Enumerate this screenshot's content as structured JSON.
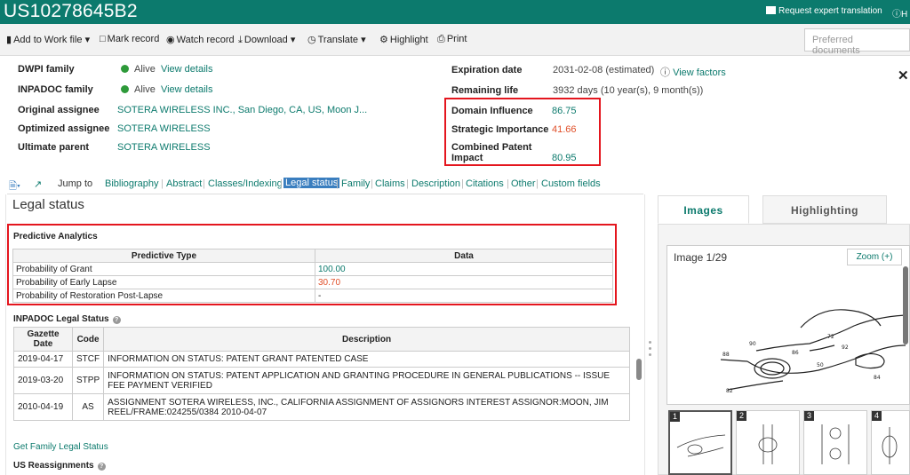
{
  "header": {
    "patent_number": "US10278645B2",
    "request_translation": "Request expert translation",
    "help": "H"
  },
  "toolbar": {
    "add_to_work_file": "Add to Work file",
    "mark_record": "Mark record",
    "watch_record": "Watch record",
    "download": "Download",
    "translate": "Translate",
    "highlight": "Highlight",
    "print": "Print",
    "preferred_placeholder": "Preferred documents"
  },
  "summary": {
    "dwpi_family_label": "DWPI family",
    "dwpi_family_status": "Alive",
    "dwpi_family_link": "View details",
    "inpadoc_family_label": "INPADOC family",
    "inpadoc_family_status": "Alive",
    "inpadoc_family_link": "View details",
    "original_assignee_label": "Original assignee",
    "original_assignee_value": "SOTERA WIRELESS INC., San Diego, CA, US, Moon J...",
    "optimized_assignee_label": "Optimized assignee",
    "optimized_assignee_value": "SOTERA WIRELESS",
    "ultimate_parent_label": "Ultimate parent",
    "ultimate_parent_value": "SOTERA WIRELESS",
    "expiration_label": "Expiration date",
    "expiration_value": "2031-02-08 (estimated)",
    "view_factors": "View factors",
    "remaining_label": "Remaining life",
    "remaining_value": "3932 days (10 year(s), 9 month(s))",
    "domain_influence_label": "Domain Influence",
    "domain_influence_value": "86.75",
    "strategic_importance_label": "Strategic Importance",
    "strategic_importance_value": "41.66",
    "combined_impact_label_1": "Combined Patent",
    "combined_impact_label_2": "Impact",
    "combined_impact_value": "80.95"
  },
  "jumpbar": {
    "jump_to": "Jump to",
    "items": [
      "Bibliography",
      "Abstract",
      "Classes/Indexing",
      "Legal status",
      "Family",
      "Claims",
      "Description",
      "Citations",
      "Other",
      "Custom fields"
    ]
  },
  "legal": {
    "title": "Legal status",
    "predictive_title": "Predictive Analytics",
    "pa_headers": [
      "Predictive Type",
      "Data"
    ],
    "pa_rows": [
      {
        "type": "Probability of Grant",
        "data": "100.00",
        "color": "#0c7a6d"
      },
      {
        "type": "Probability of Early Lapse",
        "data": "30.70",
        "color": "#e0502a"
      },
      {
        "type": "Probability of Restoration Post-Lapse",
        "data": "-",
        "color": "#444444"
      }
    ],
    "inpadoc_title": "INPADOC Legal Status",
    "ip_headers": [
      "Gazette Date",
      "Code",
      "Description"
    ],
    "ip_rows": [
      {
        "date": "2019-04-17",
        "code": "STCF",
        "desc": "INFORMATION ON STATUS: PATENT GRANT PATENTED CASE"
      },
      {
        "date": "2019-03-20",
        "code": "STPP",
        "desc": "INFORMATION ON STATUS: PATENT APPLICATION AND GRANTING PROCEDURE IN GENERAL PUBLICATIONS -- ISSUE FEE PAYMENT VERIFIED"
      },
      {
        "date": "2010-04-19",
        "code": "AS",
        "desc": "ASSIGNMENT SOTERA WIRELESS, INC., CALIFORNIA ASSIGNMENT OF ASSIGNORS INTEREST ASSIGNOR:MOON, JIM REEL/FRAME:024255/0384 2010-04-07"
      }
    ],
    "family_link": "Get Family Legal Status",
    "reassignments": "US Reassignments"
  },
  "images": {
    "tab_images": "Images",
    "tab_highlighting": "Highlighting",
    "counter": "Image 1/29",
    "zoom": "Zoom (+)",
    "thumbs": [
      "1",
      "2",
      "3",
      "4"
    ]
  },
  "colors": {
    "brand": "#0c7a6d",
    "alert": "#e0502a",
    "highlight_box": "#e4161e"
  }
}
